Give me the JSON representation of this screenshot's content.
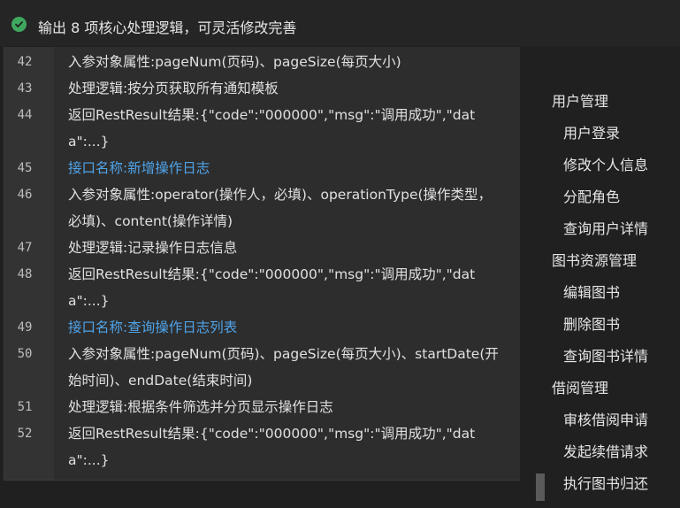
{
  "header": {
    "title": "输出 8 项核心处理逻辑，可灵活修改完善"
  },
  "code_lines": [
    {
      "num": "42",
      "text": "入参对象属性:pageNum(页码)、pageSize(每页大小)",
      "type": "normal"
    },
    {
      "num": "43",
      "text": "处理逻辑:按分页获取所有通知模板",
      "type": "normal"
    },
    {
      "num": "44",
      "text": "返回RestResult结果:{\"code\":\"000000\",\"msg\":\"调用成功\",\"data\":...}",
      "type": "normal"
    },
    {
      "num": "45",
      "text": "接口名称:新增操作日志",
      "type": "heading"
    },
    {
      "num": "46",
      "text": "入参对象属性:operator(操作人，必填)、operationType(操作类型，必填)、content(操作详情)",
      "type": "normal"
    },
    {
      "num": "47",
      "text": "处理逻辑:记录操作日志信息",
      "type": "normal"
    },
    {
      "num": "48",
      "text": "返回RestResult结果:{\"code\":\"000000\",\"msg\":\"调用成功\",\"data\":...}",
      "type": "normal"
    },
    {
      "num": "49",
      "text": "接口名称:查询操作日志列表",
      "type": "heading"
    },
    {
      "num": "50",
      "text": "入参对象属性:pageNum(页码)、pageSize(每页大小)、startDate(开始时间)、endDate(结束时间)",
      "type": "normal"
    },
    {
      "num": "51",
      "text": "处理逻辑:根据条件筛选并分页显示操作日志",
      "type": "normal"
    },
    {
      "num": "52",
      "text": "返回RestResult结果:{\"code\":\"000000\",\"msg\":\"调用成功\",\"data\":...}",
      "type": "normal"
    }
  ],
  "sidebar": {
    "groups": [
      {
        "title": "用户管理",
        "items": [
          "用户登录",
          "修改个人信息",
          "分配角色",
          "查询用户详情"
        ]
      },
      {
        "title": "图书资源管理",
        "items": [
          "编辑图书",
          "删除图书",
          "查询图书详情"
        ]
      },
      {
        "title": "借阅管理",
        "items": [
          "审核借阅申请",
          "发起续借请求",
          "执行图书归还"
        ]
      }
    ]
  },
  "colors": {
    "accent_heading": "#4fa3e8",
    "success_check": "#3fa85f"
  },
  "icons": {
    "header_status": "check-circle-icon"
  }
}
